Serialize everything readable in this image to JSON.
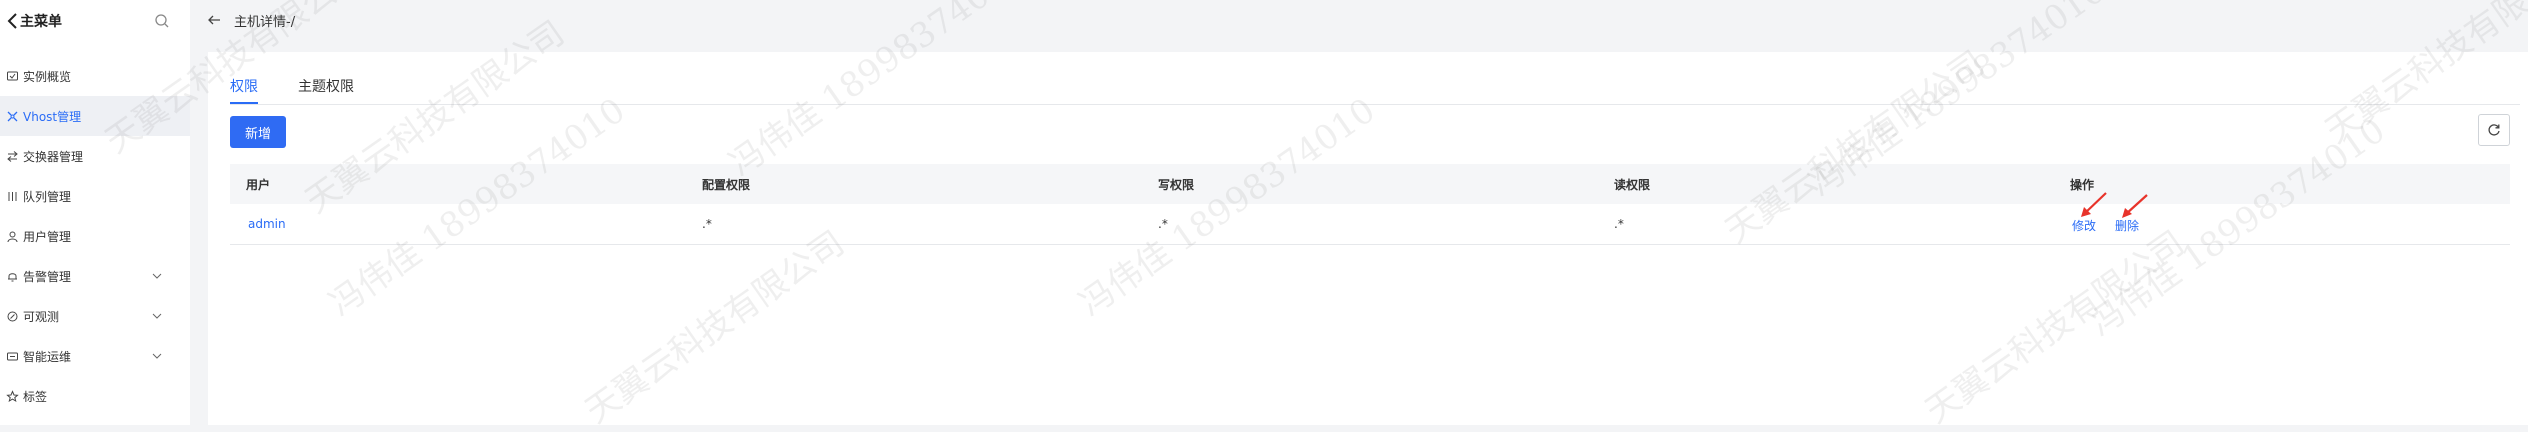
{
  "sidebar": {
    "title": "主菜单",
    "items": [
      {
        "label": "实例概览",
        "icon": "dashboard-icon",
        "active": false,
        "expandable": false
      },
      {
        "label": "Vhost管理",
        "icon": "vhost-icon",
        "active": true,
        "expandable": false
      },
      {
        "label": "交换器管理",
        "icon": "exchange-icon",
        "active": false,
        "expandable": false
      },
      {
        "label": "队列管理",
        "icon": "queue-icon",
        "active": false,
        "expandable": false
      },
      {
        "label": "用户管理",
        "icon": "user-icon",
        "active": false,
        "expandable": false
      },
      {
        "label": "告警管理",
        "icon": "alarm-icon",
        "active": false,
        "expandable": true
      },
      {
        "label": "可观测",
        "icon": "observe-icon",
        "active": false,
        "expandable": true
      },
      {
        "label": "智能运维",
        "icon": "ops-icon",
        "active": false,
        "expandable": true
      },
      {
        "label": "标签",
        "icon": "tag-icon",
        "active": false,
        "expandable": false
      }
    ]
  },
  "header": {
    "title": "主机详情-/"
  },
  "tabs": [
    {
      "label": "权限",
      "active": true
    },
    {
      "label": "主题权限",
      "active": false
    }
  ],
  "toolbar": {
    "add_label": "新增"
  },
  "table": {
    "columns": [
      "用户",
      "配置权限",
      "写权限",
      "读权限",
      "操作"
    ],
    "rows": [
      {
        "user": "admin",
        "config": ".*",
        "write": ".*",
        "read": ".*",
        "actions": [
          "修改",
          "删除"
        ]
      }
    ]
  },
  "colors": {
    "accent": "#2a6cf6",
    "annotation": "#e8332a"
  },
  "watermark": {
    "company": "天翼云科技有限公司",
    "person": "冯伟佳 18998374010"
  }
}
